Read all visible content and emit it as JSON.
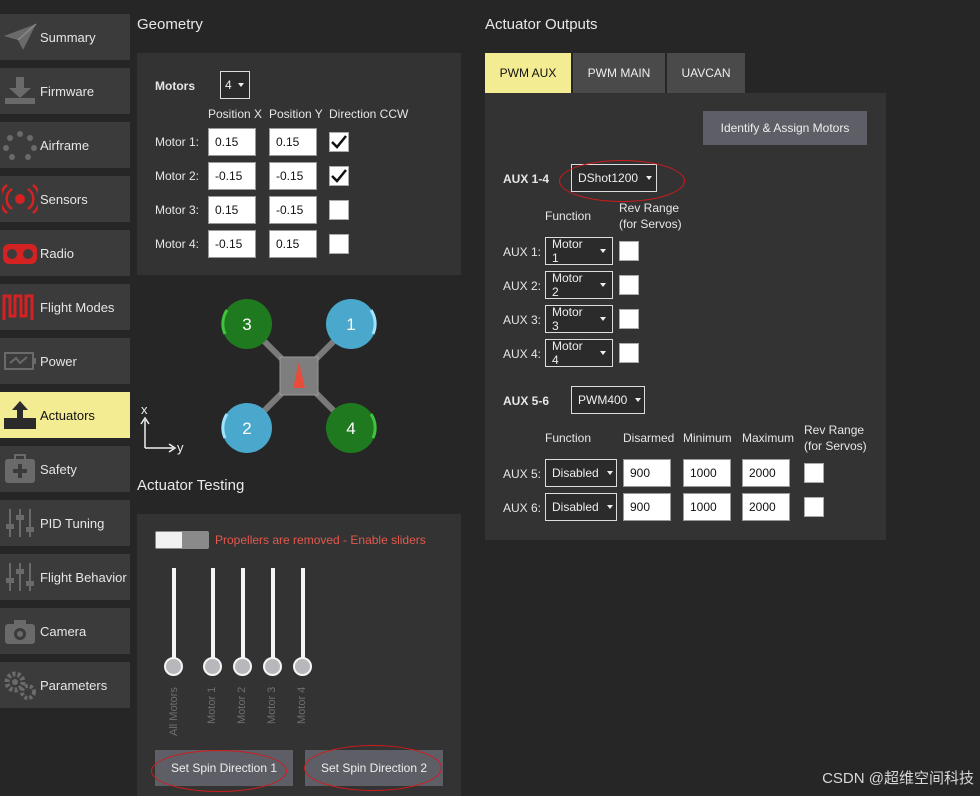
{
  "sidebar": {
    "items": [
      {
        "label": "Summary",
        "icon": "paper-plane-icon"
      },
      {
        "label": "Firmware",
        "icon": "download-icon"
      },
      {
        "label": "Airframe",
        "icon": "airframe-icon"
      },
      {
        "label": "Sensors",
        "icon": "sensors-icon"
      },
      {
        "label": "Radio",
        "icon": "radio-icon"
      },
      {
        "label": "Flight Modes",
        "icon": "flight-modes-icon"
      },
      {
        "label": "Power",
        "icon": "power-icon"
      },
      {
        "label": "Actuators",
        "icon": "actuators-icon",
        "active": true
      },
      {
        "label": "Safety",
        "icon": "safety-icon"
      },
      {
        "label": "PID Tuning",
        "icon": "sliders-icon"
      },
      {
        "label": "Flight Behavior",
        "icon": "sliders-icon"
      },
      {
        "label": "Camera",
        "icon": "camera-icon"
      },
      {
        "label": "Parameters",
        "icon": "gears-icon"
      }
    ]
  },
  "geometry": {
    "title": "Geometry",
    "motors_label": "Motors",
    "motors_count": "4",
    "col_pos_x": "Position X",
    "col_pos_y": "Position Y",
    "col_dir": "Direction CCW",
    "rows": [
      {
        "label": "Motor 1:",
        "x": "0.15",
        "y": "0.15",
        "ccw": true
      },
      {
        "label": "Motor 2:",
        "x": "-0.15",
        "y": "-0.15",
        "ccw": true
      },
      {
        "label": "Motor 3:",
        "x": "0.15",
        "y": "-0.15",
        "ccw": false
      },
      {
        "label": "Motor 4:",
        "x": "-0.15",
        "y": "0.15",
        "ccw": false
      }
    ],
    "diagram": {
      "motor_labels": [
        "1",
        "2",
        "3",
        "4"
      ],
      "axis_x": "x",
      "axis_y": "y",
      "colors": {
        "ccw_motor": "#1f7a1f",
        "cw_motor": "#4aa8cc",
        "arrow": "#e74c3c"
      }
    }
  },
  "testing": {
    "title": "Actuator Testing",
    "toggle_text": "Propellers are removed - Enable sliders",
    "sliders": [
      "All Motors",
      "Motor 1",
      "Motor 2",
      "Motor 3",
      "Motor 4"
    ],
    "btn_spin1": "Set Spin Direction 1",
    "btn_spin2": "Set Spin Direction 2"
  },
  "outputs": {
    "title": "Actuator Outputs",
    "tabs": [
      "PWM AUX",
      "PWM MAIN",
      "UAVCAN"
    ],
    "identify_btn": "Identify & Assign Motors",
    "group1": {
      "label": "AUX 1-4",
      "protocol": "DShot1200",
      "col_function": "Function",
      "col_rev_line1": "Rev Range",
      "col_rev_line2": "(for Servos)",
      "rows": [
        {
          "label": "AUX 1:",
          "function": "Motor 1"
        },
        {
          "label": "AUX 2:",
          "function": "Motor 2"
        },
        {
          "label": "AUX 3:",
          "function": "Motor 3"
        },
        {
          "label": "AUX 4:",
          "function": "Motor 4"
        }
      ]
    },
    "group2": {
      "label": "AUX 5-6",
      "protocol": "PWM400",
      "col_function": "Function",
      "col_disarmed": "Disarmed",
      "col_min": "Minimum",
      "col_max": "Maximum",
      "col_rev_line1": "Rev Range",
      "col_rev_line2": "(for Servos)",
      "rows": [
        {
          "label": "AUX 5:",
          "function": "Disabled",
          "disarmed": "900",
          "min": "1000",
          "max": "2000"
        },
        {
          "label": "AUX 6:",
          "function": "Disabled",
          "disarmed": "900",
          "min": "1000",
          "max": "2000"
        }
      ]
    }
  },
  "watermark": "CSDN @超维空间科技"
}
